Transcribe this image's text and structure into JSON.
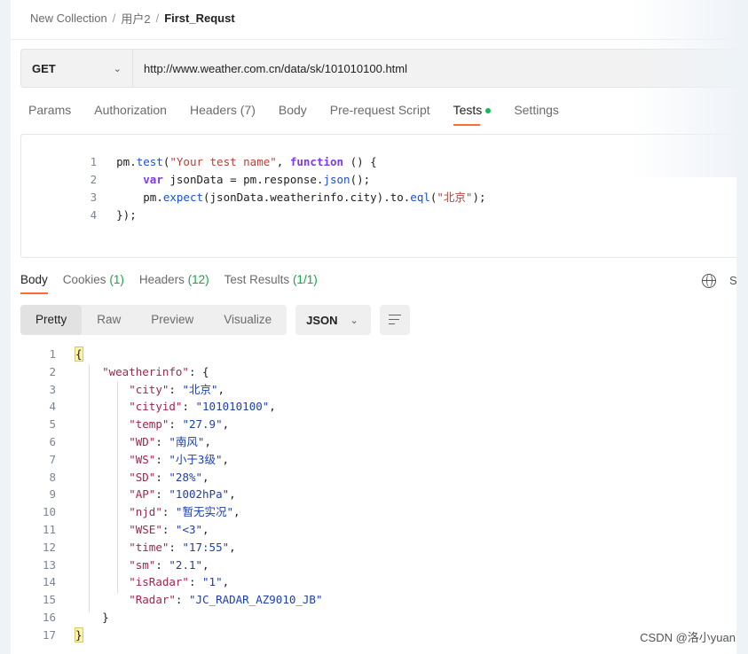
{
  "breadcrumb": {
    "collection": "New Collection",
    "folder": "用户2",
    "request": "First_Requst",
    "separator": "/"
  },
  "request": {
    "method": "GET",
    "url": "http://www.weather.com.cn/data/sk/101010100.html"
  },
  "request_tabs": [
    {
      "label": "Params"
    },
    {
      "label": "Authorization"
    },
    {
      "label": "Headers (7)"
    },
    {
      "label": "Body"
    },
    {
      "label": "Pre-request Script"
    },
    {
      "label": "Tests",
      "active": true,
      "indicator": "green-dot"
    },
    {
      "label": "Settings"
    }
  ],
  "tests_script": {
    "line_numbers": [
      "1",
      "2",
      "3",
      "4"
    ],
    "l1_a": "pm.",
    "l1_fn": "test",
    "l1_b": "(",
    "l1_str": "\"Your test name\"",
    "l1_c": ", ",
    "l1_kw": "function",
    "l1_d": " () {",
    "l2_kw": "var",
    "l2_a": " jsonData = pm.response.",
    "l2_fn": "json",
    "l2_b": "();",
    "l3_a": "pm.",
    "l3_fn": "expect",
    "l3_b": "(jsonData.weatherinfo.city).to.",
    "l3_fn2": "eql",
    "l3_c": "(",
    "l3_str": "\"北京\"",
    "l3_d": ");",
    "l4": "});"
  },
  "response_tabs": [
    {
      "label": "Body",
      "active": true
    },
    {
      "label": "Cookies",
      "count": "(1)"
    },
    {
      "label": "Headers",
      "count": "(12)"
    },
    {
      "label": "Test Results",
      "count": "(1/1)"
    }
  ],
  "response_right_letter": "S",
  "view_modes": [
    {
      "label": "Pretty",
      "active": true
    },
    {
      "label": "Raw"
    },
    {
      "label": "Preview"
    },
    {
      "label": "Visualize"
    }
  ],
  "format": "JSON",
  "response_body": {
    "open": "{",
    "root_key": "\"weatherinfo\"",
    "pairs": [
      {
        "k": "\"city\"",
        "v": "\"北京\""
      },
      {
        "k": "\"cityid\"",
        "v": "\"101010100\""
      },
      {
        "k": "\"temp\"",
        "v": "\"27.9\""
      },
      {
        "k": "\"WD\"",
        "v": "\"南风\""
      },
      {
        "k": "\"WS\"",
        "v": "\"小于3级\""
      },
      {
        "k": "\"SD\"",
        "v": "\"28%\""
      },
      {
        "k": "\"AP\"",
        "v": "\"1002hPa\""
      },
      {
        "k": "\"njd\"",
        "v": "\"暂无实况\""
      },
      {
        "k": "\"WSE\"",
        "v": "\"<3\""
      },
      {
        "k": "\"time\"",
        "v": "\"17:55\""
      },
      {
        "k": "\"sm\"",
        "v": "\"2.1\""
      },
      {
        "k": "\"isRadar\"",
        "v": "\"1\""
      },
      {
        "k": "\"Radar\"",
        "v": "\"JC_RADAR_AZ9010_JB\""
      }
    ],
    "inner_close": "}",
    "close": "}"
  },
  "watermark": "CSDN @洛小yuan",
  "colors": {
    "accent": "#ff6c37",
    "success": "#0cbb52"
  }
}
